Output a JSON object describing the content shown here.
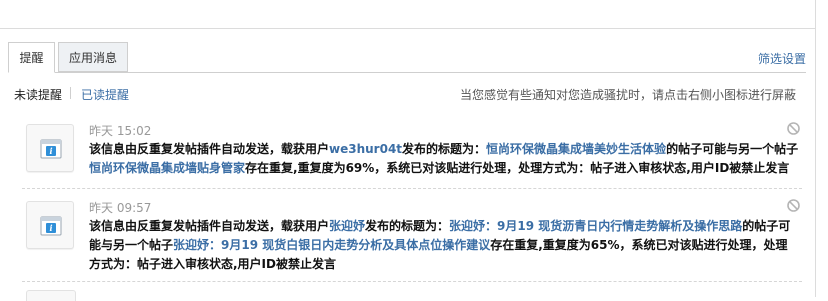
{
  "tabs": [
    {
      "label": "提醒",
      "active": true
    },
    {
      "label": "应用消息",
      "active": false
    }
  ],
  "filter_settings_label": "筛选设置",
  "subnav": {
    "unread_label": "未读提醒",
    "read_label": "已读提醒",
    "hint": "当您感觉有些通知对您造成骚扰时，请点击右侧小图标进行屏蔽"
  },
  "icons": {
    "notice": "app-notice-icon",
    "ignore": "block-icon"
  },
  "colors": {
    "link": "#3b6ea5",
    "icon_blue": "#2f8fd8"
  },
  "notifications": [
    {
      "time": "昨天 15:02",
      "t1": "该信息由反重复发帖插件自动发送，载获用户",
      "user": "we3hur04t",
      "t2": "发布的标题为：",
      "post1": "恒尚环保微晶集成墙美妙生活体验",
      "t3": "的帖子可能与另一个帖子",
      "post2": "恒尚环保微晶集成墙贴身管家",
      "t4": "存在重复,重复度为69%，系统已对该贴进行处理，处理方式为：帖子进入审核状态,用户ID被禁止发言"
    },
    {
      "time": "昨天 09:57",
      "t1": "该信息由反重复发帖插件自动发送，载获用户",
      "user": "张迎妤",
      "t2": "发布的标题为：",
      "post1": "张迎妤：9月19 现货沥青日内行情走势解析及操作思路",
      "t3": "的帖子可能与另一个帖子",
      "post2": "张迎妤：9月19 现货白银日内走势分析及具体点位操作建议",
      "t4": "存在重复,重复度为65%，系统已对该贴进行处理，处理方式为：帖子进入审核状态,用户ID被禁止发言"
    }
  ]
}
